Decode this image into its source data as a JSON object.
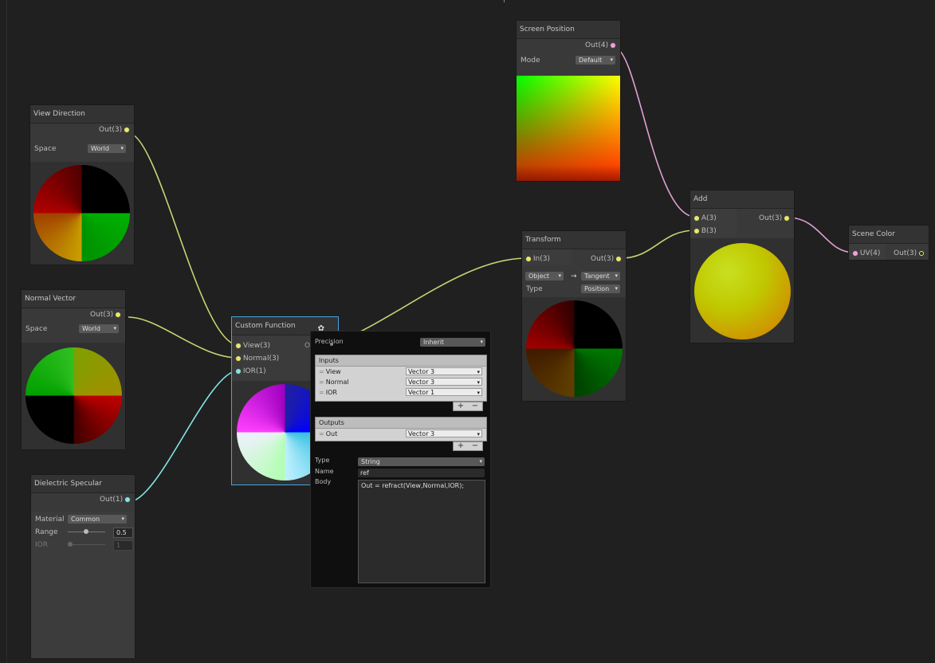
{
  "nodes": {
    "view_direction": {
      "title": "View Direction",
      "out": "Out(3)",
      "space_label": "Space",
      "space_value": "World"
    },
    "normal_vector": {
      "title": "Normal Vector",
      "out": "Out(3)",
      "space_label": "Space",
      "space_value": "World"
    },
    "dielectric_specular": {
      "title": "Dielectric Specular",
      "out": "Out(1)",
      "material_label": "Material",
      "material_value": "Common",
      "range_label": "Range",
      "range_value": "0.5",
      "range_level": 0.5,
      "ior_label": "IOR",
      "ior_value": "1"
    },
    "custom_function": {
      "title": "Custom Function",
      "inputs": [
        "View(3)",
        "Normal(3)",
        "IOR(1)"
      ],
      "out": "Out(3)"
    },
    "screen_position": {
      "title": "Screen Position",
      "out": "Out(4)",
      "mode_label": "Mode",
      "mode_value": "Default"
    },
    "transform": {
      "title": "Transform",
      "in": "In(3)",
      "out": "Out(3)",
      "from": "Object",
      "arrow": "→",
      "to": "Tangent",
      "type_label": "Type",
      "type_value": "Position"
    },
    "add": {
      "title": "Add",
      "in_a": "A(3)",
      "in_b": "B(3)",
      "out": "Out(3)"
    },
    "scene_color": {
      "title": "Scene Color",
      "in": "UV(4)",
      "out": "Out(3)"
    }
  },
  "settings_panel": {
    "precision_label": "Precision",
    "precision_value": "Inherit",
    "inputs_header": "Inputs",
    "inputs": [
      {
        "name": "View",
        "type": "Vector 3"
      },
      {
        "name": "Normal",
        "type": "Vector 3"
      },
      {
        "name": "IOR",
        "type": "Vector 1"
      }
    ],
    "outputs_header": "Outputs",
    "outputs": [
      {
        "name": "Out",
        "type": "Vector 3"
      }
    ],
    "plus": "+",
    "minus": "−",
    "type_label": "Type",
    "type_value": "String",
    "name_label": "Name",
    "name_value": "ref",
    "body_label": "Body",
    "body_value": "Out = refract(View,Normal,IOR);"
  },
  "colors": {
    "wire_vec3": "#c9d373",
    "wire_vec1": "#84e4e7",
    "wire_vec4": "#e0a0d0",
    "selection": "#44a5e0"
  }
}
